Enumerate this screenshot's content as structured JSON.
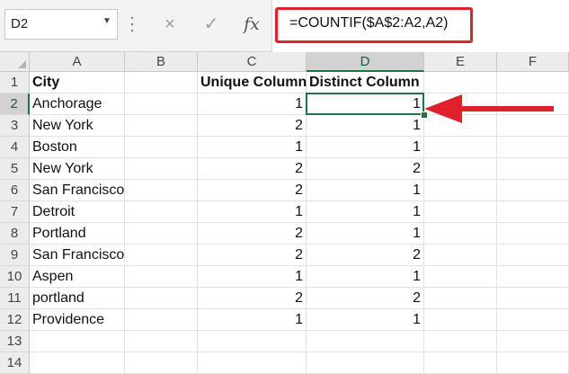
{
  "formula_bar": {
    "name_box": "D2",
    "cancel_icon": "×",
    "enter_icon": "✓",
    "fx_label": "fx",
    "formula": "=COUNTIF($A$2:A2,A2)"
  },
  "columns": [
    "A",
    "B",
    "C",
    "D",
    "E",
    "F"
  ],
  "rows": [
    {
      "num": "1",
      "A": "City",
      "B": "",
      "C": "Unique Column",
      "D": "Distinct Column"
    },
    {
      "num": "2",
      "A": "Anchorage",
      "B": "",
      "C": "1",
      "D": "1"
    },
    {
      "num": "3",
      "A": "New York",
      "B": "",
      "C": "2",
      "D": "1"
    },
    {
      "num": "4",
      "A": "Boston",
      "B": "",
      "C": "1",
      "D": "1"
    },
    {
      "num": "5",
      "A": "New York",
      "B": "",
      "C": "2",
      "D": "2"
    },
    {
      "num": "6",
      "A": "San Francisco",
      "B": "",
      "C": "2",
      "D": "1"
    },
    {
      "num": "7",
      "A": "Detroit",
      "B": "",
      "C": "1",
      "D": "1"
    },
    {
      "num": "8",
      "A": "Portland",
      "B": "",
      "C": "2",
      "D": "1"
    },
    {
      "num": "9",
      "A": "San Francisco",
      "B": "",
      "C": "2",
      "D": "2"
    },
    {
      "num": "10",
      "A": "Aspen",
      "B": "",
      "C": "1",
      "D": "1"
    },
    {
      "num": "11",
      "A": "portland",
      "B": "",
      "C": "2",
      "D": "2"
    },
    {
      "num": "12",
      "A": "Providence",
      "B": "",
      "C": "1",
      "D": "1"
    },
    {
      "num": "13",
      "A": "",
      "B": "",
      "C": "",
      "D": ""
    },
    {
      "num": "14",
      "A": "",
      "B": "",
      "C": "",
      "D": ""
    }
  ],
  "selection": {
    "column": "D",
    "row": "2"
  },
  "colors": {
    "accent": "#217346",
    "highlight": "#e0202a"
  }
}
